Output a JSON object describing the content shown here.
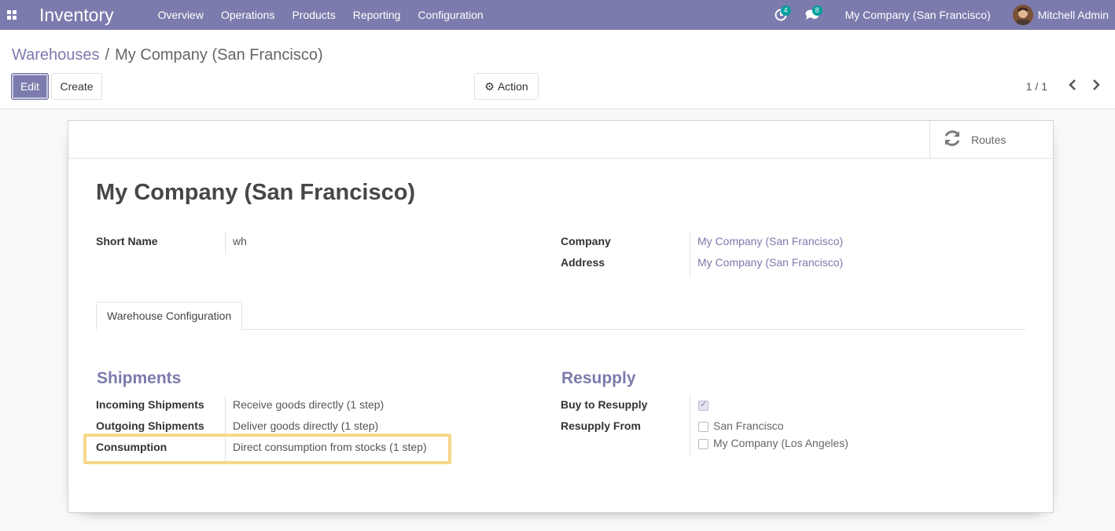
{
  "navbar": {
    "brand": "Inventory",
    "menu": [
      "Overview",
      "Operations",
      "Products",
      "Reporting",
      "Configuration"
    ],
    "activity_count": "4",
    "message_count": "8",
    "company": "My Company (San Francisco)",
    "user": "Mitchell Admin",
    "bg_color": "#7c7bad"
  },
  "breadcrumb": {
    "parent": "Warehouses",
    "separator": "/",
    "current": "My Company (San Francisco)"
  },
  "buttons": {
    "edit": "Edit",
    "create": "Create",
    "action": "Action",
    "routes": "Routes"
  },
  "pager": {
    "value": "1 / 1"
  },
  "form": {
    "title": "My Company (San Francisco)",
    "short_name_label": "Short Name",
    "short_name_value": "wh",
    "company_label": "Company",
    "company_value": "My Company (San Francisco)",
    "address_label": "Address",
    "address_value": "My Company (San Francisco)",
    "tab_label": "Warehouse Configuration",
    "shipments": {
      "title": "Shipments",
      "incoming_label": "Incoming Shipments",
      "incoming_value": "Receive goods directly (1 step)",
      "outgoing_label": "Outgoing Shipments",
      "outgoing_value": "Deliver goods directly (1 step)",
      "consumption_label": "Consumption",
      "consumption_value": "Direct consumption from stocks (1 step)"
    },
    "resupply": {
      "title": "Resupply",
      "buy_label": "Buy to Resupply",
      "buy_checked": true,
      "from_label": "Resupply From",
      "options": [
        "San Francisco",
        "My Company (Los Angeles)"
      ]
    }
  }
}
